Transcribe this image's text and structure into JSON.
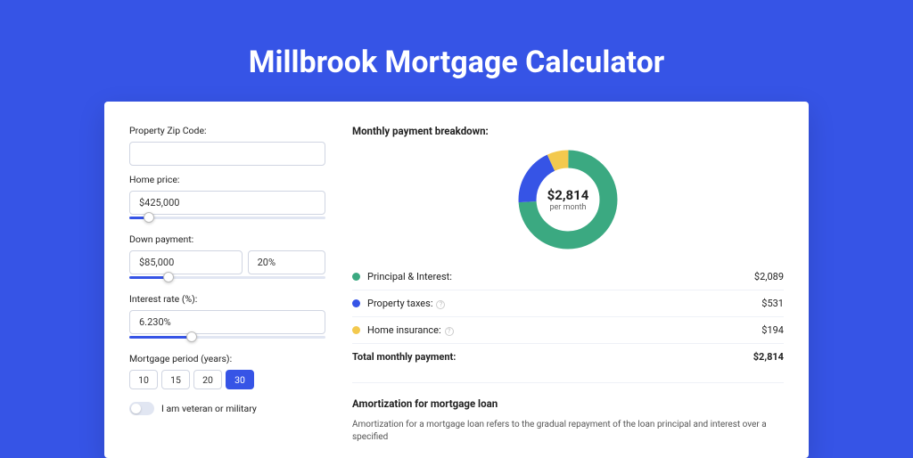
{
  "title": "Millbrook Mortgage Calculator",
  "form": {
    "zip_label": "Property Zip Code:",
    "zip_value": "",
    "price_label": "Home price:",
    "price_value": "$425,000",
    "price_slider_pct": 10,
    "down_label": "Down payment:",
    "down_value": "$85,000",
    "down_pct_value": "20%",
    "down_slider_pct": 20,
    "rate_label": "Interest rate (%):",
    "rate_value": "6.230%",
    "rate_slider_pct": 32,
    "period_label": "Mortgage period (years):",
    "periods": [
      "10",
      "15",
      "20",
      "30"
    ],
    "period_selected": "30",
    "veteran_label": "I am veteran or military",
    "veteran_checked": false
  },
  "breakdown": {
    "title": "Monthly payment breakdown:",
    "amount": "$2,814",
    "amount_sub": "per month",
    "items": [
      {
        "label": "Principal & Interest:",
        "amount": "$2,089",
        "color": "#3ba981",
        "info": false
      },
      {
        "label": "Property taxes:",
        "amount": "$531",
        "color": "#3654e6",
        "info": true
      },
      {
        "label": "Home insurance:",
        "amount": "$194",
        "color": "#f3c94e",
        "info": true
      }
    ],
    "total_label": "Total monthly payment:",
    "total_amount": "$2,814"
  },
  "amort": {
    "title": "Amortization for mortgage loan",
    "text": "Amortization for a mortgage loan refers to the gradual repayment of the loan principal and interest over a specified"
  },
  "chart_data": {
    "type": "pie",
    "title": "Monthly payment breakdown",
    "series": [
      {
        "name": "Principal & Interest",
        "value": 2089,
        "color": "#3ba981"
      },
      {
        "name": "Property taxes",
        "value": 531,
        "color": "#3654e6"
      },
      {
        "name": "Home insurance",
        "value": 194,
        "color": "#f3c94e"
      }
    ],
    "total": 2814,
    "center_label": "$2,814 per month"
  }
}
